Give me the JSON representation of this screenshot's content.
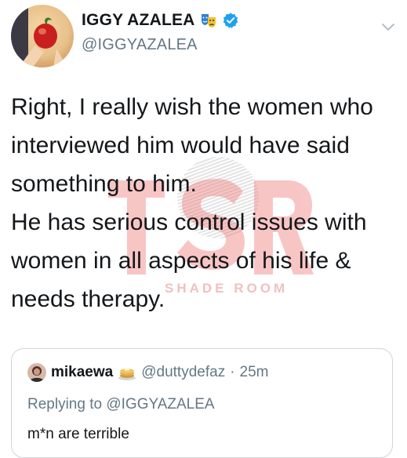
{
  "tweet": {
    "display_name": "IGGY AZALEA",
    "handle": "@IGGYAZALEA",
    "name_emoji_icon": "theater-masks-icon",
    "verified_icon": "verified-badge-icon",
    "menu_icon": "chevron-down-icon",
    "text_lines": [
      "Right, I really wish the women who",
      "interviewed him would have said",
      "something to him.",
      "He has serious control issues with",
      "women in all aspects of his life &",
      "needs therapy."
    ]
  },
  "watermark": {
    "logo_text": "TSR",
    "caption": "SHADE ROOM"
  },
  "quoted_tweet": {
    "display_name": "mikaewa",
    "name_emoji_icon": "pancakes-icon",
    "handle": "@duttydefaz",
    "separator": "·",
    "time": "25m",
    "replying_prefix": "Replying to ",
    "replying_to": "@IGGYAZALEA",
    "text": "m*n are terrible"
  },
  "colors": {
    "text_primary": "#14171a",
    "text_secondary": "#657786",
    "verified_blue": "#1da1f2",
    "border": "#ccd6dd",
    "watermark_red": "#e85d5d"
  }
}
